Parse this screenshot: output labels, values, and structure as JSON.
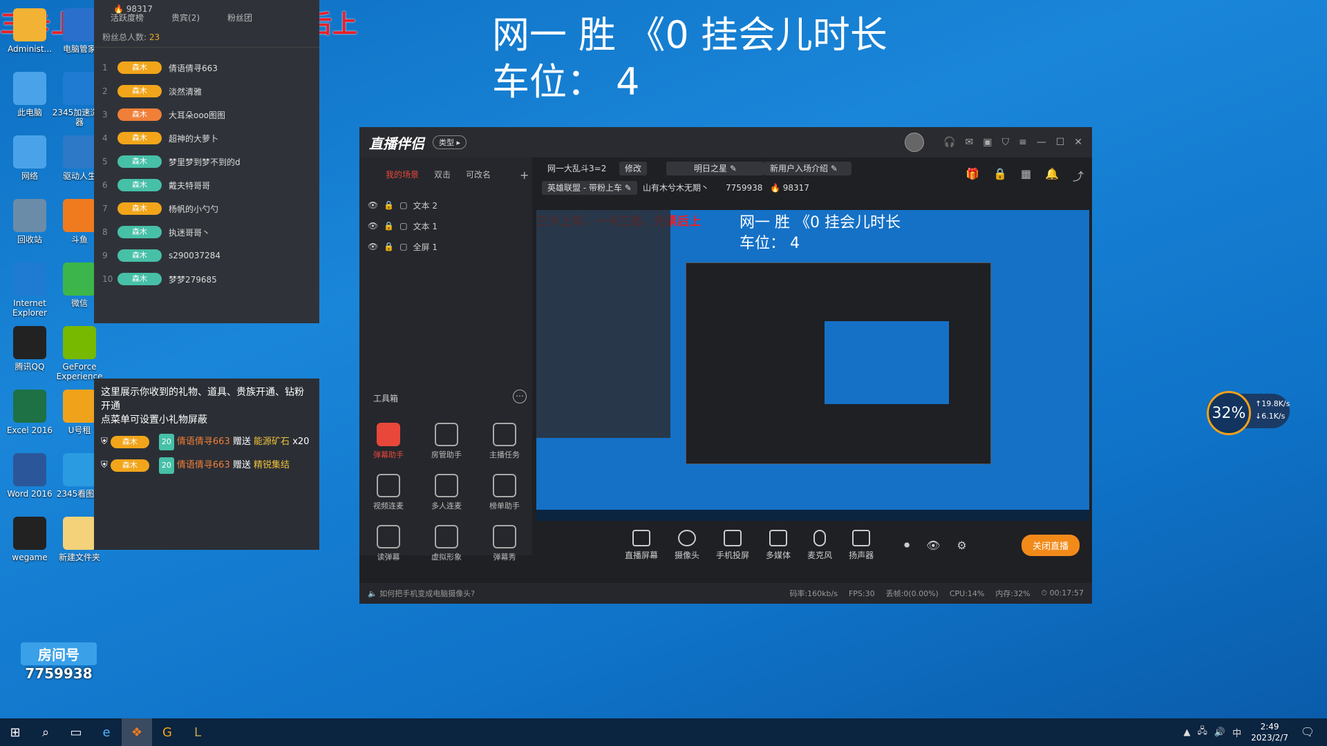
{
  "overlay": {
    "red_caption": "三卡上车，一卡三局，先票后上",
    "line1": "网一   胜 《0  挂会儿时长",
    "line2": "车位：  4"
  },
  "desktop_icons": [
    {
      "label": "Administ...",
      "color": "#f2b233"
    },
    {
      "label": "电脑管家",
      "color": "#2b6fcc"
    },
    {
      "label": "此电脑",
      "color": "#4aa3e8"
    },
    {
      "label": "2345加速浏览器",
      "color": "#1f7ad1"
    },
    {
      "label": "网络",
      "color": "#4aa3e8"
    },
    {
      "label": "驱动人生",
      "color": "#2d79c7"
    },
    {
      "label": "回收站",
      "color": "#6b8ca8"
    },
    {
      "label": "斗鱼",
      "color": "#f07a1e"
    },
    {
      "label": "Internet Explorer",
      "color": "#1f7ad1"
    },
    {
      "label": "微信",
      "color": "#3cb64a"
    },
    {
      "label": "腾讯QQ",
      "color": "#222222"
    },
    {
      "label": "GeForce Experience",
      "color": "#76b900"
    },
    {
      "label": "Excel 2016",
      "color": "#1d7145"
    },
    {
      "label": "U号租",
      "color": "#f0a21a"
    },
    {
      "label": "Word 2016",
      "color": "#2b579a"
    },
    {
      "label": "2345看图王",
      "color": "#2a9be0"
    },
    {
      "label": "wegame",
      "color": "#222222"
    },
    {
      "label": "新建文件夹",
      "color": "#f3d27a"
    }
  ],
  "fans": {
    "top_count": "98317",
    "tabs": [
      "活跃度榜",
      "贵宾(2)",
      "粉丝团"
    ],
    "total_label": "粉丝总人数:",
    "total_value": "23",
    "rows": [
      {
        "rank": "1",
        "badge": "森木",
        "name": "倩语倩寻663",
        "color": "#f2a51a"
      },
      {
        "rank": "2",
        "badge": "森木",
        "name": "淡然清雅",
        "color": "#f2a51a"
      },
      {
        "rank": "3",
        "badge": "森木",
        "name": "大耳朵ooo图图",
        "color": "#f07f38"
      },
      {
        "rank": "4",
        "badge": "森木",
        "name": "超神的大萝卜",
        "color": "#f2a51a"
      },
      {
        "rank": "5",
        "badge": "森木",
        "name": "梦里梦到梦不到的d",
        "color": "#47c0a8"
      },
      {
        "rank": "6",
        "badge": "森木",
        "name": "戴夫特哥哥",
        "color": "#47c0a8"
      },
      {
        "rank": "7",
        "badge": "森木",
        "name": "杨帆的小勺勺",
        "color": "#f2a51a"
      },
      {
        "rank": "8",
        "badge": "森木",
        "name": "执迷哥哥丶",
        "color": "#47c0a8"
      },
      {
        "rank": "9",
        "badge": "森木",
        "name": "s290037284",
        "color": "#47c0a8"
      },
      {
        "rank": "10",
        "badge": "森木",
        "name": "梦梦279685",
        "color": "#47c0a8"
      }
    ]
  },
  "gifts": {
    "intro": "这里展示你收到的礼物、道具、贵族开通、钻粉开通",
    "intro2": "点菜单可设置小礼物屏蔽",
    "items": [
      {
        "badge": "森木",
        "lvl": "20",
        "user": "倩语倩寻663",
        "verb": "赠送",
        "gift": "能源矿石",
        "count": "x20"
      },
      {
        "badge": "森木",
        "lvl": "20",
        "user": "倩语倩寻663",
        "verb": "赠送",
        "gift": "精锐集结",
        "count": ""
      }
    ]
  },
  "room": {
    "label": "房间号",
    "number": "7759938"
  },
  "app": {
    "logo": "直播伴侣",
    "type_pill": "类型",
    "scene_tabs": [
      "我的场景",
      "双击",
      "可改名"
    ],
    "sources": [
      "文本 2",
      "文本 1",
      "全屏 1"
    ],
    "toolbox_title": "工具箱",
    "tools": [
      "弹幕助手",
      "房管助手",
      "主播任务",
      "视频连麦",
      "多人连麦",
      "榜单助手",
      "读弹幕",
      "虚拟形象",
      "弹幕秀"
    ],
    "stream_title": "网一大乱斗3=2",
    "edit_label": "修改",
    "star_label": "明日之星",
    "entry_label": "新用户入场介绍",
    "category": "英雄联盟 - 带粉上车",
    "streamer": "山有木兮木无期丶",
    "room_id": "7759938",
    "heat": "98317",
    "preview_line1": "网一   胜 《0  挂会儿时长",
    "preview_line2": "车位：  4",
    "preview_red": "三卡上车，一卡三局，先票后上",
    "bottom_buttons": [
      "直播屏幕",
      "摄像头",
      "手机投屏",
      "多媒体",
      "麦克风",
      "扬声器"
    ],
    "stop_label": "关闭直播",
    "tip": "如何把手机变成电脑摄像头?",
    "status": {
      "bitrate": "码率:160kb/s",
      "fps": "FPS:30",
      "drop": "丢帧:0(0.00%)",
      "cpu": "CPU:14%",
      "mem": "内存:32%",
      "time": "00:17:57"
    }
  },
  "speed_widget": {
    "percent": "32%",
    "up": "19.8K/s",
    "down": "6.1K/s"
  },
  "taskbar": {
    "ime": "中",
    "time": "2:49",
    "date": "2023/2/7"
  }
}
